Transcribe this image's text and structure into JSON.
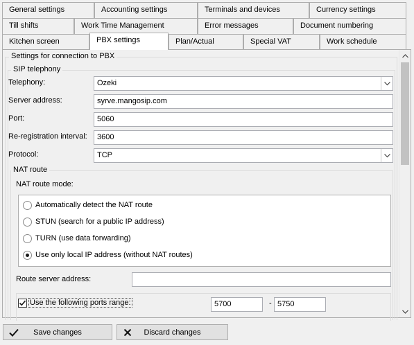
{
  "tabs": {
    "row1": [
      "General settings",
      "Accounting settings",
      "Terminals and devices",
      "Currency settings"
    ],
    "row2": [
      "Till shifts",
      "Work Time Management",
      "Error messages",
      "Document numbering"
    ],
    "row3": [
      "Kitchen screen",
      "PBX settings",
      "Plan/Actual",
      "Special VAT",
      "Work schedule"
    ],
    "active": "PBX settings"
  },
  "pbx": {
    "section_title": "Settings for connection to PBX",
    "sip": {
      "title": "SIP telephony",
      "telephony_label": "Telephony:",
      "telephony_value": "Ozeki",
      "server_label": "Server address:",
      "server_value": "syrve.mangosip.com",
      "port_label": "Port:",
      "port_value": "5060",
      "rereg_label": "Re-registration interval:",
      "rereg_value": "3600",
      "protocol_label": "Protocol:",
      "protocol_value": "TCP"
    },
    "nat": {
      "title": "NAT route",
      "mode_label": "NAT route mode:",
      "options": [
        "Automatically detect the NAT route",
        "STUN (search for a public IP address)",
        "TURN (use data forwarding)",
        "Use only local IP address (without NAT routes)"
      ],
      "selected_index": 3,
      "route_server_label": "Route server address:",
      "route_server_value": ""
    },
    "ports": {
      "checkbox_label": "Use the following ports range:",
      "checked": true,
      "from": "5700",
      "separator": "-",
      "to": "5750"
    }
  },
  "buttons": {
    "save": "Save changes",
    "discard": "Discard changes"
  },
  "icons": {
    "save": "checkmark-icon",
    "discard": "cross-icon",
    "dropdown": "chevron-down-icon",
    "scroll_up": "chevron-up-icon",
    "scroll_down": "chevron-down-icon"
  }
}
